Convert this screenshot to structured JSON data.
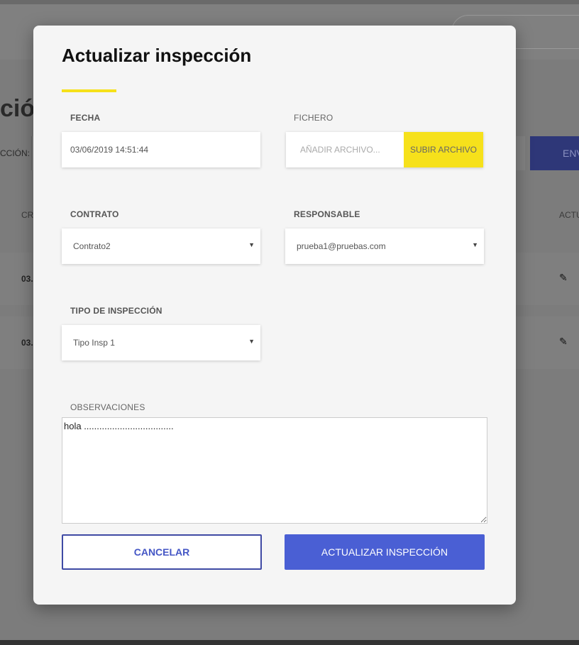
{
  "background": {
    "page_title_partial": "ció",
    "filter_label_partial": "CCIÓN:",
    "send_button_partial": "ENV",
    "col_left_partial": "CR",
    "col_right_partial": "ACTU",
    "rows": [
      {
        "date_partial": "03."
      },
      {
        "date_partial": "03."
      }
    ]
  },
  "modal": {
    "title": "Actualizar inspección",
    "accent_color": "#f6e11b",
    "fecha": {
      "label": "FECHA",
      "value": "03/06/2019 14:51:44"
    },
    "fichero": {
      "label": "FICHERO",
      "placeholder": "AÑADIR ARCHIVO...",
      "button_label": "SUBIR ARCHIVO"
    },
    "contrato": {
      "label": "CONTRATO",
      "value": "Contrato2"
    },
    "responsable": {
      "label": "RESPONSABLE",
      "value": "prueba1@pruebas.com"
    },
    "tipo": {
      "label": "TIPO DE INSPECCIÓN",
      "value": "Tipo Insp 1"
    },
    "observaciones": {
      "label": "OBSERVACIONES",
      "value": "hola ..................................."
    },
    "buttons": {
      "cancel": "CANCELAR",
      "submit": "ACTUALIZAR INSPECCIÓN",
      "submit_color": "#4a5fd4"
    }
  }
}
